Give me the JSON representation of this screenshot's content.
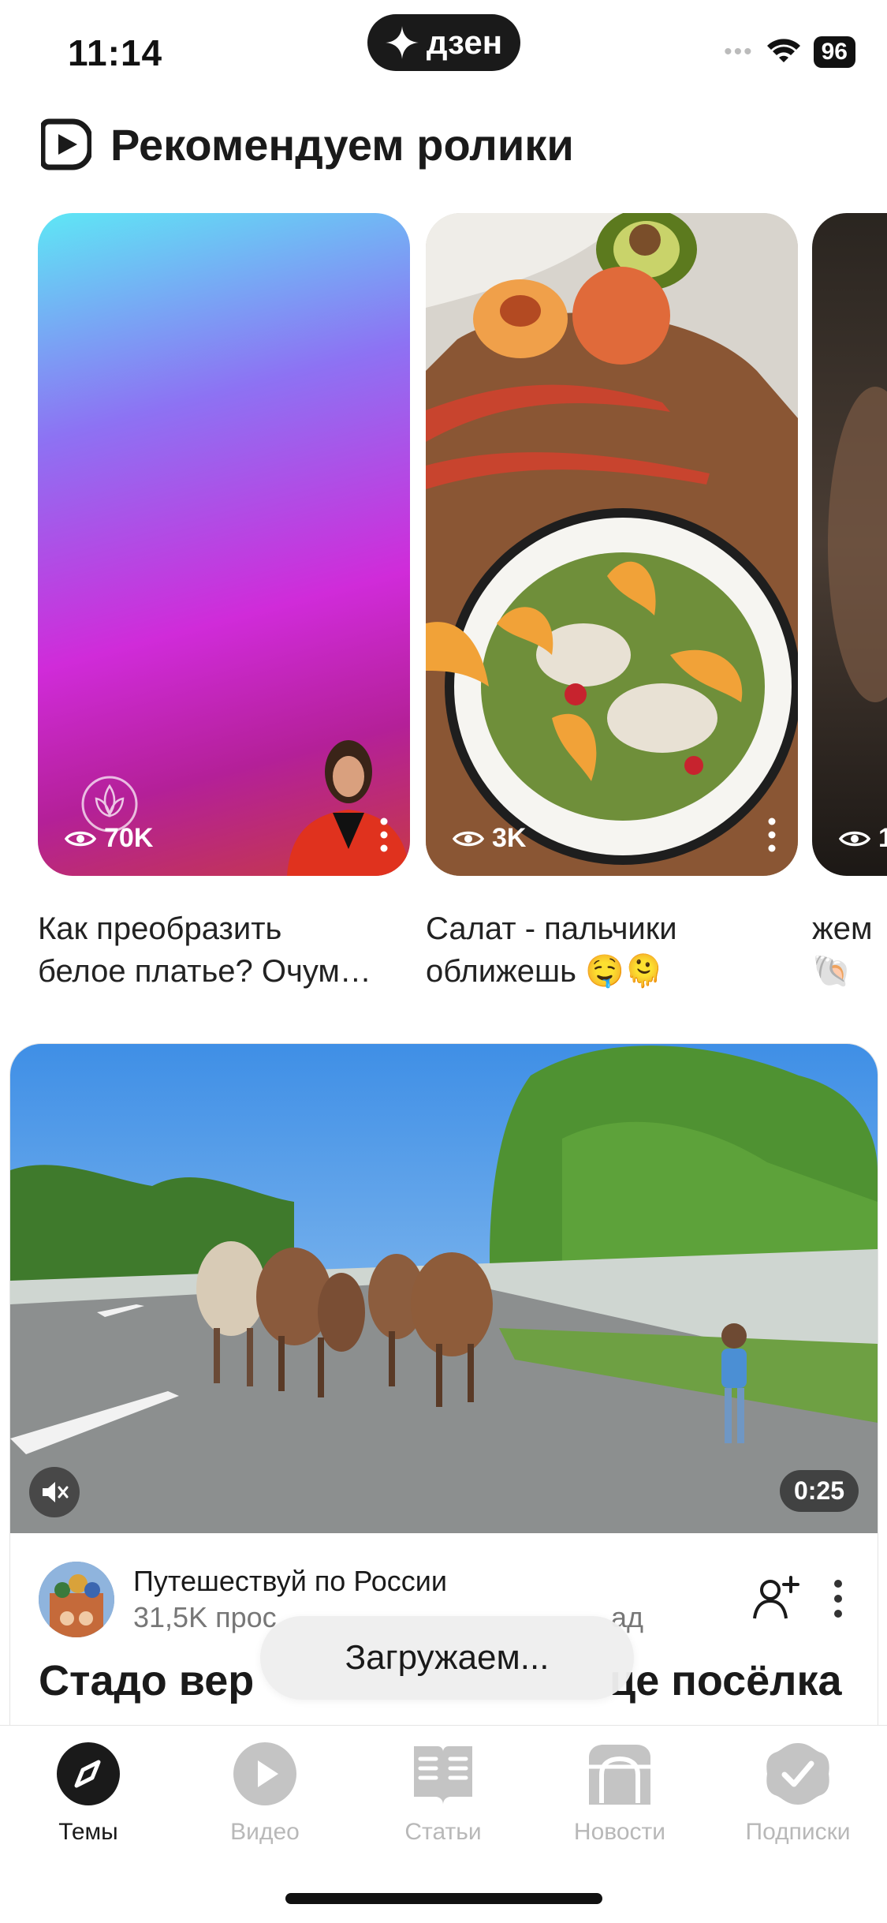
{
  "status_bar": {
    "time": "11:14",
    "brand": "дзен",
    "battery": "96"
  },
  "section": {
    "title": "Рекомендуем ролики"
  },
  "shorts": [
    {
      "views": "70K",
      "caption_line1": "Как преобразить",
      "caption_line2": "белое платье? Очум…"
    },
    {
      "views": "3K",
      "caption_line1": "Салат - пальчики",
      "caption_line2": "оближешь 🤤🫠"
    },
    {
      "views": "1",
      "caption_line1": "жем",
      "caption_line2": "🐚"
    }
  ],
  "video": {
    "duration": "0:25",
    "channel_name": "Путешествуй по России",
    "channel_meta": "31,5K прос",
    "meta_suffix": "ад",
    "title_start": "Стадо вер",
    "title_end": "це посёлка"
  },
  "toast": {
    "text": "Загружаем..."
  },
  "tabs": [
    {
      "label": "Темы",
      "active": true
    },
    {
      "label": "Видео",
      "active": false
    },
    {
      "label": "Статьи",
      "active": false
    },
    {
      "label": "Новости",
      "active": false
    },
    {
      "label": "Подписки",
      "active": false
    }
  ],
  "colors": {
    "active_tab": "#1a1a1a",
    "inactive_tab": "#b8b8b8",
    "icon_inactive": "#c4c4c4"
  }
}
